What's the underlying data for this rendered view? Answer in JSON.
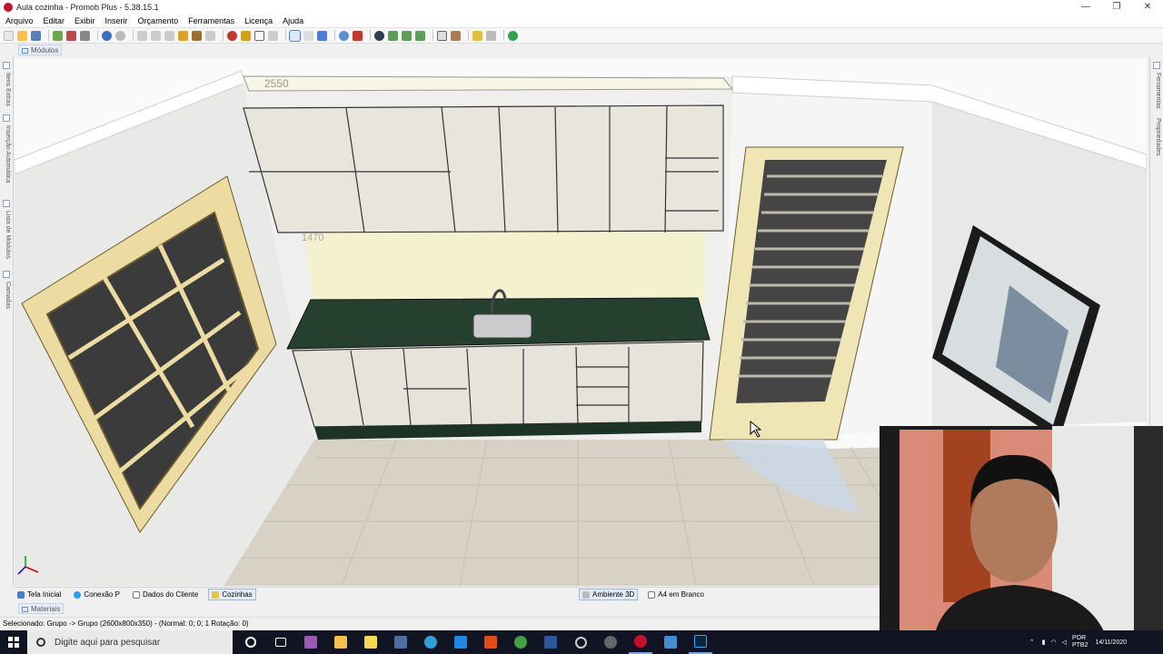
{
  "window": {
    "title": "Aula cozinha - Promob Plus - 5.38.15.1",
    "controls": [
      "—",
      "❐",
      "✕"
    ]
  },
  "menu": [
    "Arquivo",
    "Editar",
    "Exibir",
    "Inserir",
    "Orçamento",
    "Ferramentas",
    "Licença",
    "Ajuda"
  ],
  "module_tab": "Módulos",
  "left_panel": [
    "Itens Extras",
    "Inserção Automática",
    "Lista de Módulos",
    "Camadas"
  ],
  "right_panel": [
    "Ferramentas",
    "Propriedades"
  ],
  "scene": {
    "dimension_top": "2550",
    "dimension_wall": "1470"
  },
  "doc_tabs": [
    "Tela Inicial",
    "Conexão P",
    "Dados do Cliente",
    "Cozinhas"
  ],
  "view_tabs": [
    "Ambiente 3D",
    "A4 em Branco"
  ],
  "materials_tab": "Materiais",
  "status": "Selecionado: Grupo -> Grupo (2600x800x350) - (Normal: 0; 0; 1 Rotação: 0)",
  "taskbar": {
    "search_placeholder": "Digite aqui para pesquisar",
    "lang_top": "POR",
    "lang_bottom": "PTB2",
    "date": "14/11/2020"
  },
  "colors": {
    "accent": "#4a7dd3",
    "taskbar": "#101423",
    "promob_red": "#c8102e"
  }
}
